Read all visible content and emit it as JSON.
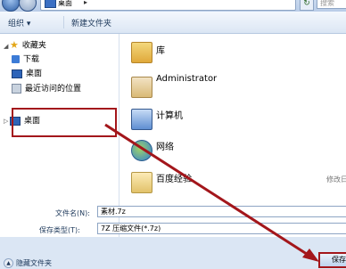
{
  "address": {
    "segment": "桌面",
    "search_placeholder": "搜索"
  },
  "toolbar": {
    "organize": "组织 ▾",
    "new_folder": "新建文件夹"
  },
  "sidebar": {
    "favorites": "收藏夹",
    "items": [
      {
        "label": "下载"
      },
      {
        "label": "桌面"
      },
      {
        "label": "最近访问的位置"
      }
    ],
    "desktop_root": "桌面"
  },
  "main": {
    "items": [
      {
        "label": "库",
        "meta": ""
      },
      {
        "label": "Administrator",
        "meta": ""
      },
      {
        "label": "计算机",
        "meta": ""
      },
      {
        "label": "网络",
        "meta": ""
      },
      {
        "label": "百度经验",
        "meta": "修改日"
      }
    ]
  },
  "form": {
    "filename_label": "文件名(N):",
    "filename_value": "素材.7z",
    "filetype_label": "保存类型(T):",
    "filetype_value": "7Z 压缩文件(*.7z)",
    "hide_folders": "隐藏文件夹",
    "save_label": "保存"
  },
  "colors": {
    "highlight": "#a3161b",
    "window_bg": "#dbe6f4"
  }
}
